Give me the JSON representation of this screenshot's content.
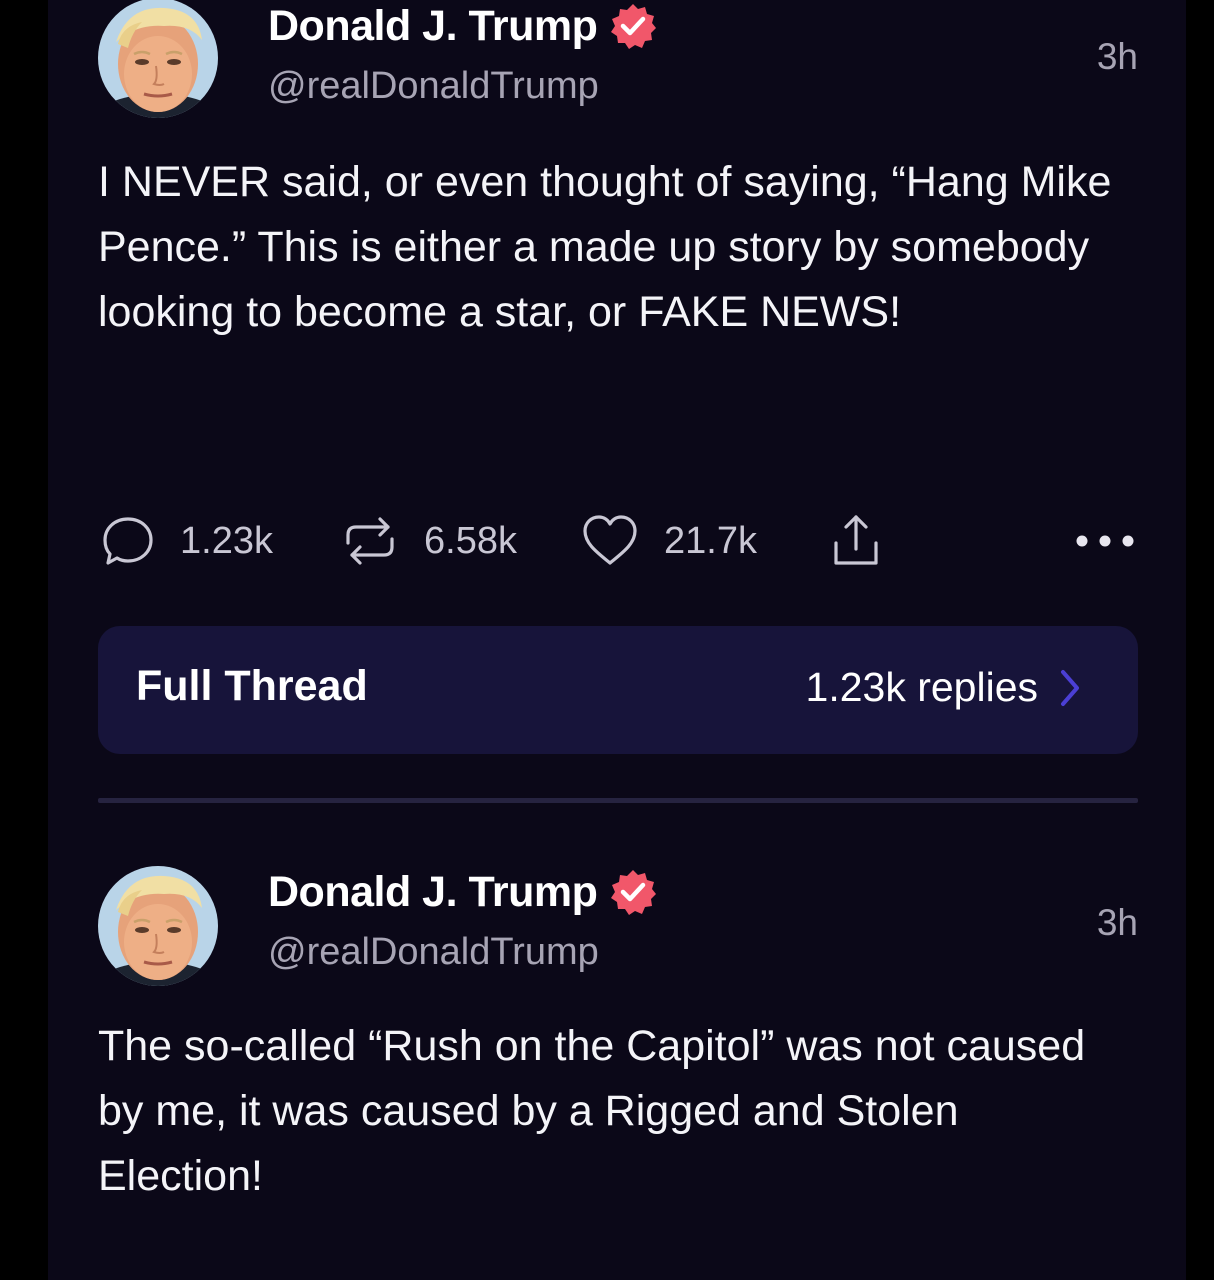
{
  "posts": [
    {
      "author": {
        "display_name": "Donald J. Trump",
        "handle": "@realDonaldTrump",
        "verified": true
      },
      "time": "3h",
      "text": "I NEVER said, or even thought of saying, “Hang Mike Pence.” This is either a made up story by somebody looking to become a star, or FAKE NEWS!",
      "stats": {
        "replies": "1.23k",
        "reposts": "6.58k",
        "likes": "21.7k"
      },
      "thread": {
        "label": "Full Thread",
        "replies": "1.23k replies"
      }
    },
    {
      "author": {
        "display_name": "Donald J. Trump",
        "handle": "@realDonaldTrump",
        "verified": true
      },
      "time": "3h",
      "text": "The so-called “Rush on the Capitol” was not caused by me, it was caused by a Rigged and Stolen Election!"
    }
  ],
  "icons": {
    "reply": "speech-bubble-icon",
    "repost": "repost-arrows-icon",
    "like": "heart-icon",
    "share": "share-upload-icon",
    "more": "more-dots-icon",
    "verified": "verified-badge-icon",
    "chevron": "chevron-right-icon"
  },
  "colors": {
    "background": "#0b0818",
    "thread_bar": "#17143a",
    "verified_badge": "#f1576a",
    "chevron": "#4b3fd4",
    "muted_text": "#a7a4b4"
  }
}
